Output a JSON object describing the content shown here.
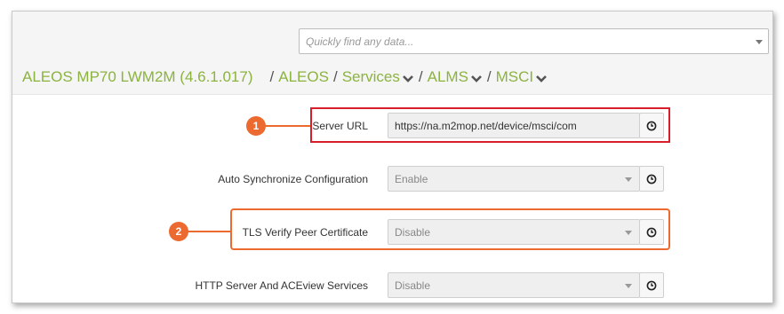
{
  "search": {
    "placeholder": "Quickly find any data..."
  },
  "breadcrumb": {
    "root": "ALEOS MP70 LWM2M (4.6.1.017)",
    "separator": "/",
    "items": [
      {
        "label": "ALEOS",
        "has_dropdown": false
      },
      {
        "label": "Services",
        "has_dropdown": true
      },
      {
        "label": "ALMS",
        "has_dropdown": true
      },
      {
        "label": "MSCI",
        "has_dropdown": true
      }
    ]
  },
  "fields": [
    {
      "label": "Server URL",
      "value": "https://na.m2mop.net/device/msci/com",
      "type": "text"
    },
    {
      "label": "Auto Synchronize Configuration",
      "value": "Enable",
      "type": "select"
    },
    {
      "label": "TLS Verify Peer Certificate",
      "value": "Disable",
      "type": "select"
    },
    {
      "label": "HTTP Server And ACEview Services",
      "value": "Disable",
      "type": "select"
    }
  ],
  "callouts": [
    {
      "number": "1",
      "color": "#ec6a2f",
      "highlight_color": "#d61f2a"
    },
    {
      "number": "2",
      "color": "#ec6a2f",
      "highlight_color": "#ec6a2f"
    }
  ],
  "colors": {
    "breadcrumb": "#8cb33f",
    "header_band": "#f5f5f5",
    "field_bg": "#efefef"
  },
  "icons": {
    "search_dropdown": "chevron-down-icon",
    "history": "clock-icon"
  }
}
